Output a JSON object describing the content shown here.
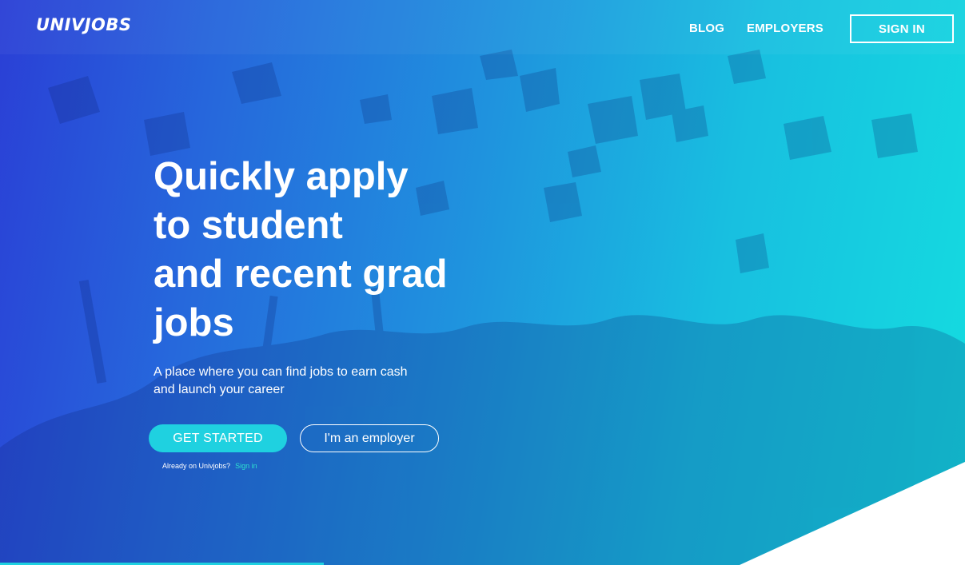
{
  "header": {
    "logo_text": "UNIVJOBS",
    "nav": {
      "blog_label": "BLOG",
      "employers_label": "EMPLOYERS",
      "signin_label": "SIGN IN"
    }
  },
  "hero": {
    "headline_lines": [
      "Quickly apply",
      "to student",
      "and recent grad",
      "jobs"
    ],
    "subtext_lines": [
      "A place where you can find jobs to earn cash",
      "and launch your career"
    ],
    "get_started_label": "GET STARTED",
    "employer_label": "I'm an employer",
    "already_text": "Already on Univjobs?",
    "already_link_label": "Sign in"
  },
  "colors": {
    "gradient_start": "#2a3fd6",
    "gradient_end": "#14dde0",
    "accent": "#1fd1e0",
    "link_accent": "#2ee0d0",
    "text": "#ffffff"
  }
}
